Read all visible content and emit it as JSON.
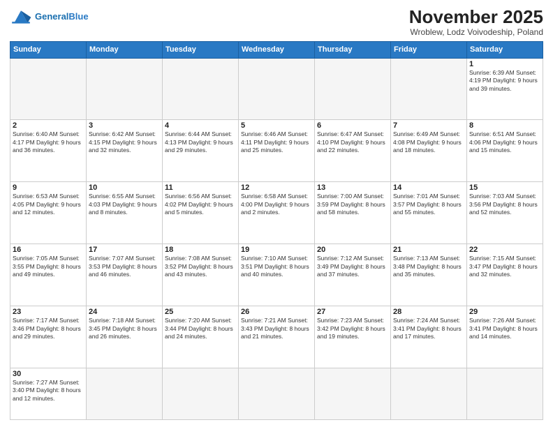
{
  "header": {
    "logo_text_general": "General",
    "logo_text_blue": "Blue",
    "month_title": "November 2025",
    "location": "Wroblew, Lodz Voivodeship, Poland"
  },
  "weekdays": [
    "Sunday",
    "Monday",
    "Tuesday",
    "Wednesday",
    "Thursday",
    "Friday",
    "Saturday"
  ],
  "weeks": [
    [
      {
        "day": "",
        "info": "",
        "empty": true
      },
      {
        "day": "",
        "info": "",
        "empty": true
      },
      {
        "day": "",
        "info": "",
        "empty": true
      },
      {
        "day": "",
        "info": "",
        "empty": true
      },
      {
        "day": "",
        "info": "",
        "empty": true
      },
      {
        "day": "",
        "info": "",
        "empty": true
      },
      {
        "day": "1",
        "info": "Sunrise: 6:39 AM\nSunset: 4:19 PM\nDaylight: 9 hours and 39 minutes."
      }
    ],
    [
      {
        "day": "2",
        "info": "Sunrise: 6:40 AM\nSunset: 4:17 PM\nDaylight: 9 hours and 36 minutes."
      },
      {
        "day": "3",
        "info": "Sunrise: 6:42 AM\nSunset: 4:15 PM\nDaylight: 9 hours and 32 minutes."
      },
      {
        "day": "4",
        "info": "Sunrise: 6:44 AM\nSunset: 4:13 PM\nDaylight: 9 hours and 29 minutes."
      },
      {
        "day": "5",
        "info": "Sunrise: 6:46 AM\nSunset: 4:11 PM\nDaylight: 9 hours and 25 minutes."
      },
      {
        "day": "6",
        "info": "Sunrise: 6:47 AM\nSunset: 4:10 PM\nDaylight: 9 hours and 22 minutes."
      },
      {
        "day": "7",
        "info": "Sunrise: 6:49 AM\nSunset: 4:08 PM\nDaylight: 9 hours and 18 minutes."
      },
      {
        "day": "8",
        "info": "Sunrise: 6:51 AM\nSunset: 4:06 PM\nDaylight: 9 hours and 15 minutes."
      }
    ],
    [
      {
        "day": "9",
        "info": "Sunrise: 6:53 AM\nSunset: 4:05 PM\nDaylight: 9 hours and 12 minutes."
      },
      {
        "day": "10",
        "info": "Sunrise: 6:55 AM\nSunset: 4:03 PM\nDaylight: 9 hours and 8 minutes."
      },
      {
        "day": "11",
        "info": "Sunrise: 6:56 AM\nSunset: 4:02 PM\nDaylight: 9 hours and 5 minutes."
      },
      {
        "day": "12",
        "info": "Sunrise: 6:58 AM\nSunset: 4:00 PM\nDaylight: 9 hours and 2 minutes."
      },
      {
        "day": "13",
        "info": "Sunrise: 7:00 AM\nSunset: 3:59 PM\nDaylight: 8 hours and 58 minutes."
      },
      {
        "day": "14",
        "info": "Sunrise: 7:01 AM\nSunset: 3:57 PM\nDaylight: 8 hours and 55 minutes."
      },
      {
        "day": "15",
        "info": "Sunrise: 7:03 AM\nSunset: 3:56 PM\nDaylight: 8 hours and 52 minutes."
      }
    ],
    [
      {
        "day": "16",
        "info": "Sunrise: 7:05 AM\nSunset: 3:55 PM\nDaylight: 8 hours and 49 minutes."
      },
      {
        "day": "17",
        "info": "Sunrise: 7:07 AM\nSunset: 3:53 PM\nDaylight: 8 hours and 46 minutes."
      },
      {
        "day": "18",
        "info": "Sunrise: 7:08 AM\nSunset: 3:52 PM\nDaylight: 8 hours and 43 minutes."
      },
      {
        "day": "19",
        "info": "Sunrise: 7:10 AM\nSunset: 3:51 PM\nDaylight: 8 hours and 40 minutes."
      },
      {
        "day": "20",
        "info": "Sunrise: 7:12 AM\nSunset: 3:49 PM\nDaylight: 8 hours and 37 minutes."
      },
      {
        "day": "21",
        "info": "Sunrise: 7:13 AM\nSunset: 3:48 PM\nDaylight: 8 hours and 35 minutes."
      },
      {
        "day": "22",
        "info": "Sunrise: 7:15 AM\nSunset: 3:47 PM\nDaylight: 8 hours and 32 minutes."
      }
    ],
    [
      {
        "day": "23",
        "info": "Sunrise: 7:17 AM\nSunset: 3:46 PM\nDaylight: 8 hours and 29 minutes."
      },
      {
        "day": "24",
        "info": "Sunrise: 7:18 AM\nSunset: 3:45 PM\nDaylight: 8 hours and 26 minutes."
      },
      {
        "day": "25",
        "info": "Sunrise: 7:20 AM\nSunset: 3:44 PM\nDaylight: 8 hours and 24 minutes."
      },
      {
        "day": "26",
        "info": "Sunrise: 7:21 AM\nSunset: 3:43 PM\nDaylight: 8 hours and 21 minutes."
      },
      {
        "day": "27",
        "info": "Sunrise: 7:23 AM\nSunset: 3:42 PM\nDaylight: 8 hours and 19 minutes."
      },
      {
        "day": "28",
        "info": "Sunrise: 7:24 AM\nSunset: 3:41 PM\nDaylight: 8 hours and 17 minutes."
      },
      {
        "day": "29",
        "info": "Sunrise: 7:26 AM\nSunset: 3:41 PM\nDaylight: 8 hours and 14 minutes."
      }
    ],
    [
      {
        "day": "30",
        "info": "Sunrise: 7:27 AM\nSunset: 3:40 PM\nDaylight: 8 hours and 12 minutes.",
        "last": true
      },
      {
        "day": "",
        "info": "",
        "empty": true,
        "last": true
      },
      {
        "day": "",
        "info": "",
        "empty": true,
        "last": true
      },
      {
        "day": "",
        "info": "",
        "empty": true,
        "last": true
      },
      {
        "day": "",
        "info": "",
        "empty": true,
        "last": true
      },
      {
        "day": "",
        "info": "",
        "empty": true,
        "last": true
      },
      {
        "day": "",
        "info": "",
        "empty": true,
        "last": true
      }
    ]
  ]
}
